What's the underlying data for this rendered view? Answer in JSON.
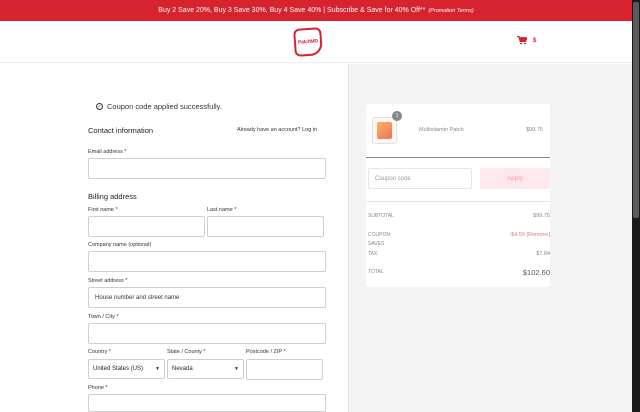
{
  "promo": {
    "text": "Buy 2 Save 20%, Buy 3 Save 30%, Buy 4 Save 40% | Subscribe & Save for 40% Off**",
    "terms": "(Promotion Terms)"
  },
  "header": {
    "logo_text": "PatchMD",
    "cart_amount": "$",
    "accent_color": "#d6232f"
  },
  "notice": {
    "text": "Coupon code applied successfully."
  },
  "contact": {
    "heading": "Contact information",
    "login_text": "Already have an account? Log in",
    "email_label": "Email address *",
    "email_value": ""
  },
  "billing": {
    "heading": "Billing address",
    "first_name_label": "First name *",
    "last_name_label": "Last name *",
    "company_label": "Company name (optional)",
    "street_label": "Street address *",
    "street_placeholder": "House number and street name",
    "town_label": "Town / City *",
    "country_label": "Country *",
    "country_value": "United States (US)",
    "state_label": "State / County *",
    "state_value": "Nevada",
    "postcode_label": "Postcode / ZIP *",
    "phone_label": "Phone *"
  },
  "summary": {
    "product_name": "Multivitamin Patch",
    "product_price": "$99.75",
    "quantity": "1",
    "coupon_placeholder": "Coupon code",
    "apply_label": "Apply",
    "subtotal_label": "SUBTOTAL",
    "subtotal_value": "$99.75",
    "coupon_label": "COUPON:",
    "coupon_code": "SAVES",
    "coupon_value": "-$4.99",
    "remove_label": "[Remove]",
    "tax_label": "TAX",
    "tax_value": "$7.84",
    "total_label": "TOTAL",
    "total_value": "$102.60"
  }
}
